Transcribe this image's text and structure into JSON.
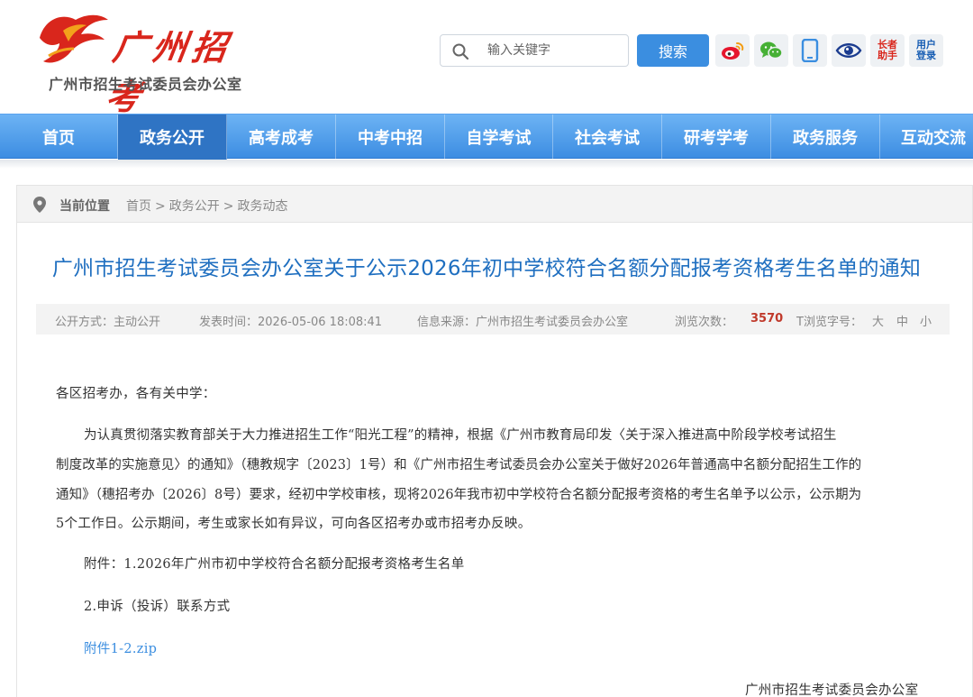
{
  "header": {
    "logo_title": "广州招考",
    "logo_subtitle": "广州市招生考试委员会办公室",
    "search": {
      "placeholder": "输入关键字",
      "button_label": "搜索"
    },
    "share": [
      {
        "name": "weibo-icon"
      },
      {
        "name": "wechat-icon"
      },
      {
        "name": "mobile-icon"
      },
      {
        "name": "eye-icon"
      },
      {
        "name": "elder-assistant",
        "label_line1": "长者",
        "label_line2": "助手"
      },
      {
        "name": "user-login",
        "label_line1": "用户",
        "label_line2": "登录"
      }
    ]
  },
  "nav": {
    "items": [
      "首页",
      "政务公开",
      "高考成考",
      "中考中招",
      "自学考试",
      "社会考试",
      "研考学考",
      "政务服务",
      "互动交流"
    ],
    "active_index": 1
  },
  "breadcrumb": {
    "label": "当前位置",
    "path": [
      "首页",
      "政务公开",
      "政务动态"
    ],
    "separator": ">"
  },
  "article": {
    "title": "广州市招生考试委员会办公室关于公示2026年初中学校符合名额分配报考资格考生名单的通知",
    "meta": {
      "disclosure": "公开方式：主动公开",
      "published": "发表时间：2026-05-06 18:08:41",
      "source": "信息来源：广州市招生考试委员会办公室",
      "views_label": "浏览次数：",
      "views": "3570",
      "font_size_label": "T浏览字号：",
      "font_sizes": [
        "大",
        "中",
        "小"
      ]
    },
    "salutation": "各区招考办，各有关中学：",
    "body_lines": [
      "为认真贯彻落实教育部关于大力推进招生工作“阳光工程”的精神，根据《广州市教育局印发〈关于深入推进高中阶段学校考试招生",
      "制度改革的实施意见〉的通知》（穗教规字〔2023〕1号）和《广州市招生考试委员会办公室关于做好2026年普通高中名额分配招生工作的",
      "通知》（穗招考办〔2026〕8号）要求，经初中学校审核，现将2026年我市初中学校符合名额分配报考资格的考生名单予以公示，公示期为",
      "5个工作日。公示期间，考生或家长如有异议，可向各区招考办或市招考办反映。"
    ],
    "attachment_line1": "附件：1.2026年广州市初中学校符合名额分配报考资格考生名单",
    "attachment_line2": "2.申诉（投诉）联系方式",
    "attachment_link": "附件1-2.zip",
    "signature": "广州市招生考试委员会办公室"
  },
  "colors": {
    "accent": "#3b8ee0",
    "title": "#1f6fc0",
    "brand_red": "#d9261c",
    "views": "#c0392b"
  }
}
